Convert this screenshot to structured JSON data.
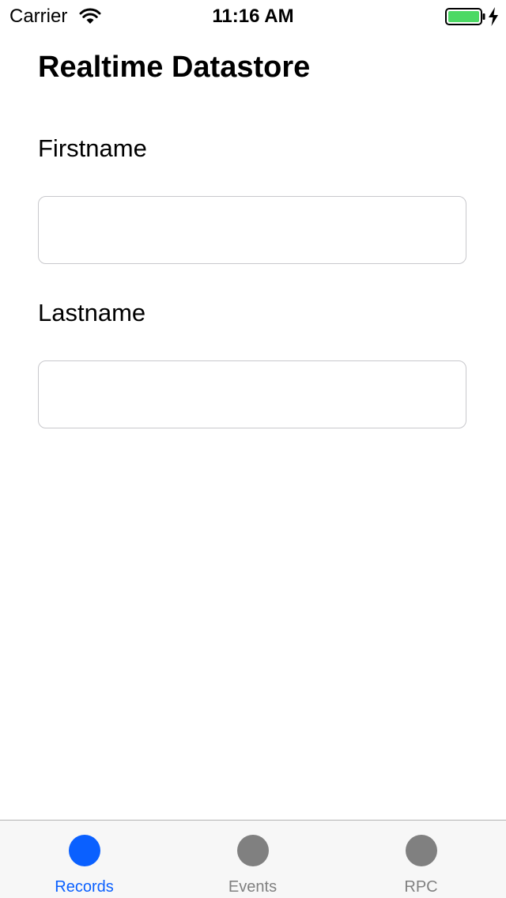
{
  "status_bar": {
    "carrier": "Carrier",
    "time": "11:16 AM",
    "battery_color": "#4cd964"
  },
  "page": {
    "title": "Realtime Datastore"
  },
  "form": {
    "firstname": {
      "label": "Firstname",
      "value": "",
      "placeholder": ""
    },
    "lastname": {
      "label": "Lastname",
      "value": "",
      "placeholder": ""
    }
  },
  "tab_bar": {
    "active_color": "#0a60ff",
    "inactive_color": "#808080",
    "tabs": [
      {
        "label": "Records",
        "icon": "circle-icon",
        "active": true
      },
      {
        "label": "Events",
        "icon": "circle-icon",
        "active": false
      },
      {
        "label": "RPC",
        "icon": "circle-icon",
        "active": false
      }
    ]
  }
}
